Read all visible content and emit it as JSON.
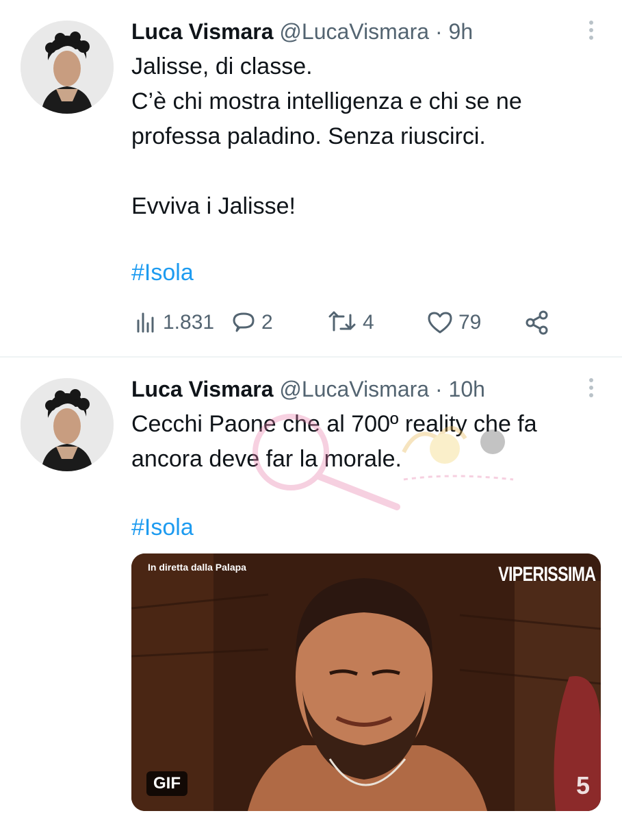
{
  "tweets": [
    {
      "author": {
        "name": "Luca Vismara",
        "handle": "@LucaVismara"
      },
      "separator": "·",
      "time": "9h",
      "text": "Jalisse, di classe.\nC’è chi mostra intelligenza e chi se ne professa paladino. Senza riuscirci.\n\nEvviva i Jalisse!",
      "hashtag": "#Isola",
      "stats": {
        "views": "1.831",
        "replies": "2",
        "retweets": "4",
        "likes": "79"
      },
      "icons": [
        "views-icon",
        "reply-icon",
        "retweet-icon",
        "like-icon",
        "share-icon",
        "more-icon"
      ]
    },
    {
      "author": {
        "name": "Luca Vismara",
        "handle": "@LucaVismara"
      },
      "separator": "·",
      "time": "10h",
      "text": "Cecchi Paone che al 700º reality che fa ancora deve far la morale.",
      "hashtag": "#Isola",
      "media": {
        "caption": "In diretta dalla Palapa",
        "brand": "VIPERISSIMA",
        "badge": "GIF",
        "channel": "5"
      }
    }
  ],
  "colors": {
    "text": "#0f1419",
    "secondary": "#536471",
    "link": "#1d9bf0",
    "divider": "#eff3f4"
  }
}
